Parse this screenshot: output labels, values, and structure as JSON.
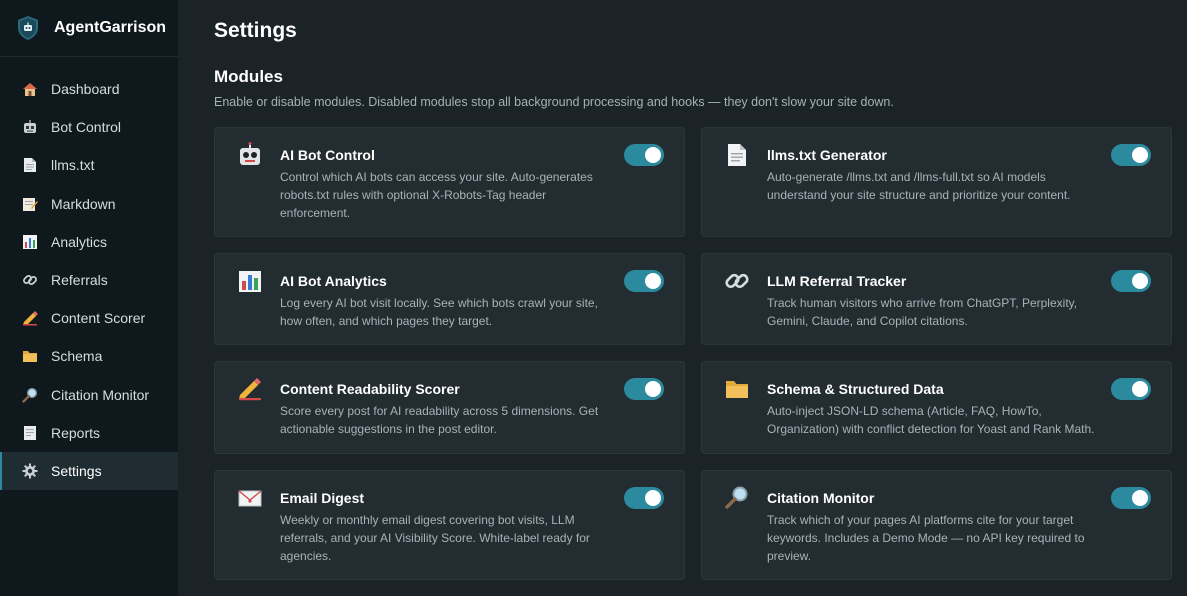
{
  "brand": {
    "name": "AgentGarrison"
  },
  "sidebar": {
    "items": [
      {
        "label": "Dashboard",
        "icon": "house-icon"
      },
      {
        "label": "Bot Control",
        "icon": "robot-icon"
      },
      {
        "label": "llms.txt",
        "icon": "document-icon"
      },
      {
        "label": "Markdown",
        "icon": "memo-icon"
      },
      {
        "label": "Analytics",
        "icon": "bar-chart-icon"
      },
      {
        "label": "Referrals",
        "icon": "link-icon"
      },
      {
        "label": "Content Scorer",
        "icon": "pencil-icon"
      },
      {
        "label": "Schema",
        "icon": "folder-icon"
      },
      {
        "label": "Citation Monitor",
        "icon": "magnifier-icon"
      },
      {
        "label": "Reports",
        "icon": "report-icon"
      },
      {
        "label": "Settings",
        "icon": "gear-icon",
        "active": true
      }
    ]
  },
  "page": {
    "title": "Settings"
  },
  "modules": {
    "title": "Modules",
    "description": "Enable or disable modules. Disabled modules stop all background processing and hooks — they don't slow your site down.",
    "cards": [
      {
        "title": "AI Bot Control",
        "icon": "robot-icon",
        "enabled": true,
        "description": "Control which AI bots can access your site. Auto-generates robots.txt rules with optional X-Robots-Tag header enforcement."
      },
      {
        "title": "llms.txt Generator",
        "icon": "document-icon",
        "enabled": true,
        "description": "Auto-generate /llms.txt and /llms-full.txt so AI models understand your site structure and prioritize your content."
      },
      {
        "title": "AI Bot Analytics",
        "icon": "bar-chart-icon",
        "enabled": true,
        "description": "Log every AI bot visit locally. See which bots crawl your site, how often, and which pages they target."
      },
      {
        "title": "LLM Referral Tracker",
        "icon": "link-icon",
        "enabled": true,
        "description": "Track human visitors who arrive from ChatGPT, Perplexity, Gemini, Claude, and Copilot citations."
      },
      {
        "title": "Content Readability Scorer",
        "icon": "pencil-icon",
        "enabled": true,
        "description": "Score every post for AI readability across 5 dimensions. Get actionable suggestions in the post editor."
      },
      {
        "title": "Schema & Structured Data",
        "icon": "folder-icon",
        "enabled": true,
        "description": "Auto-inject JSON-LD schema (Article, FAQ, HowTo, Organization) with conflict detection for Yoast and Rank Math."
      },
      {
        "title": "Email Digest",
        "icon": "envelope-icon",
        "enabled": true,
        "description": "Weekly or monthly email digest covering bot visits, LLM referrals, and your AI Visibility Score. White-label ready for agencies."
      },
      {
        "title": "Citation Monitor",
        "icon": "magnifier-icon",
        "enabled": true,
        "description": "Track which of your pages AI platforms cite for your target keywords. Includes a Demo Mode — no API key required to preview."
      }
    ]
  },
  "colors": {
    "accent": "#2b8a9e",
    "sidebar_bg": "#0f181c",
    "main_bg": "#1b2327",
    "card_bg": "#222c31"
  }
}
